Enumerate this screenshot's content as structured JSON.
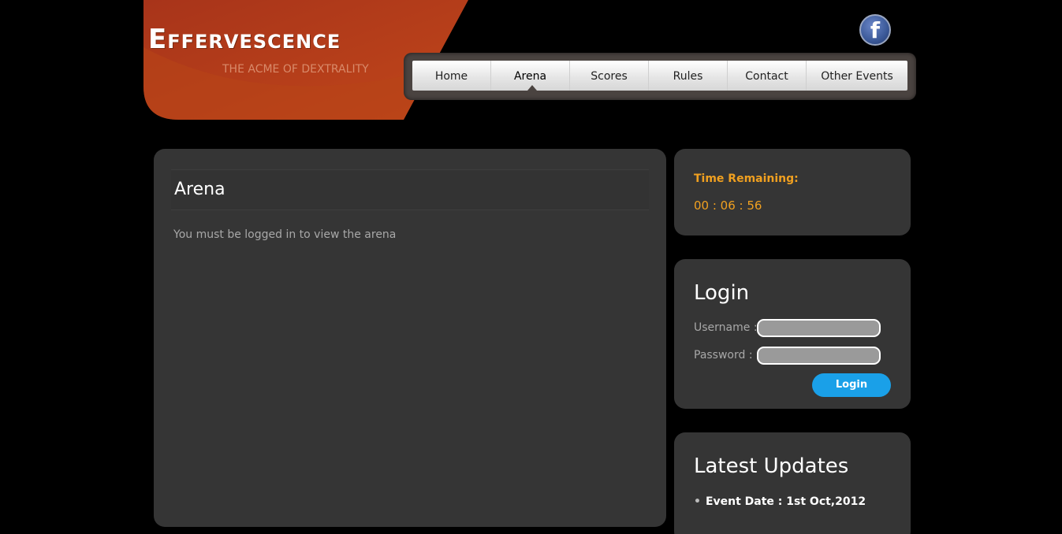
{
  "header": {
    "site_title": "Effervescence",
    "tagline": "THE ACME OF DEXTRALITY"
  },
  "social": {
    "icon": "facebook-icon",
    "glyph": "f"
  },
  "nav": {
    "items": [
      {
        "label": "Home",
        "active": false
      },
      {
        "label": "Arena",
        "active": true
      },
      {
        "label": "Scores",
        "active": false
      },
      {
        "label": "Rules",
        "active": false
      },
      {
        "label": "Contact",
        "active": false
      },
      {
        "label": "Other Events",
        "active": false
      }
    ]
  },
  "main": {
    "heading": "Arena",
    "message": "You must be logged in to view the arena"
  },
  "timer": {
    "label": "Time Remaining:",
    "value": "00 : 06 : 56"
  },
  "login": {
    "title": "Login",
    "username_label": "Username :",
    "username_value": "",
    "password_label": "Password :",
    "password_value": "",
    "button_label": "Login"
  },
  "updates": {
    "title": "Latest Updates",
    "items": [
      "Event Date : 1st Oct,2012"
    ]
  },
  "colors": {
    "background": "#000000",
    "logo_orange": "#b83a16",
    "panel": "#353535",
    "accent": "#f0a020",
    "button": "#1aa0e8"
  }
}
